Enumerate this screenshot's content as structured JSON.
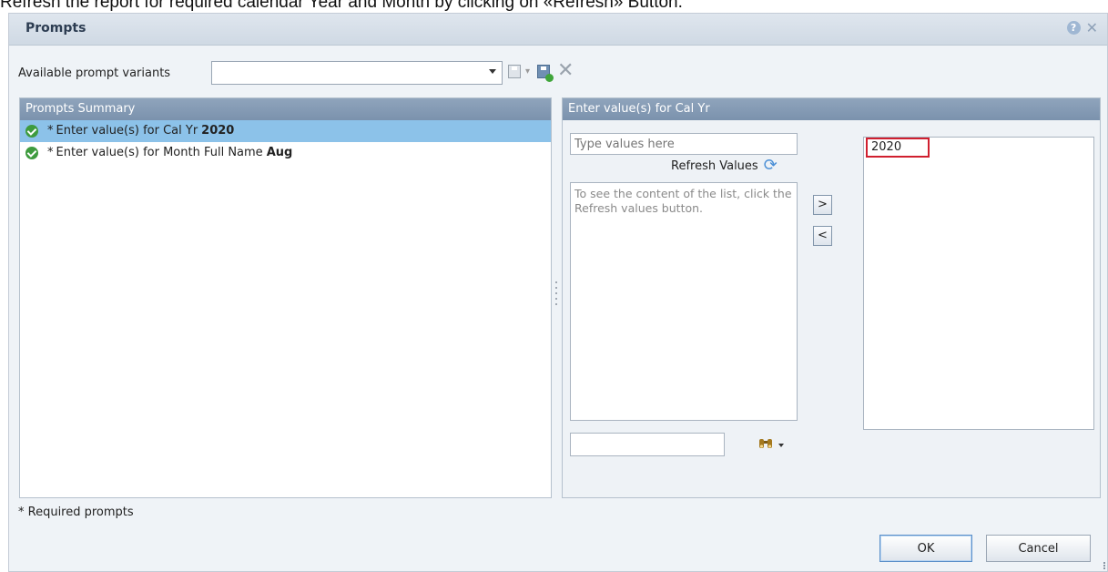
{
  "caption": "Refresh the report for required calendar Year and Month by clicking on «Refresh» Button.",
  "dialog": {
    "title": "Prompts",
    "help_icon": "?",
    "close_icon": "✕"
  },
  "variants": {
    "label": "Available prompt variants",
    "selected": "",
    "delete_icon": "✕"
  },
  "summary": {
    "header": "Prompts Summary",
    "items": [
      {
        "star": "*",
        "label": "Enter value(s) for Cal Yr",
        "value": "2020",
        "selected": true
      },
      {
        "star": "*",
        "label": "Enter value(s) for Month Full Name",
        "value": "Aug",
        "selected": false
      }
    ]
  },
  "entry": {
    "header": "Enter value(s) for Cal Yr",
    "type_placeholder": "Type values here",
    "refresh_label": "Refresh Values",
    "refresh_icon": "⟳",
    "list_hint": "To see the content of the list, click the Refresh values button.",
    "add_label": ">",
    "remove_label": "<",
    "search_icon": "🔍",
    "selected_values": [
      "2020"
    ]
  },
  "footer": {
    "required_note": "* Required prompts",
    "ok_label": "OK",
    "cancel_label": "Cancel"
  }
}
